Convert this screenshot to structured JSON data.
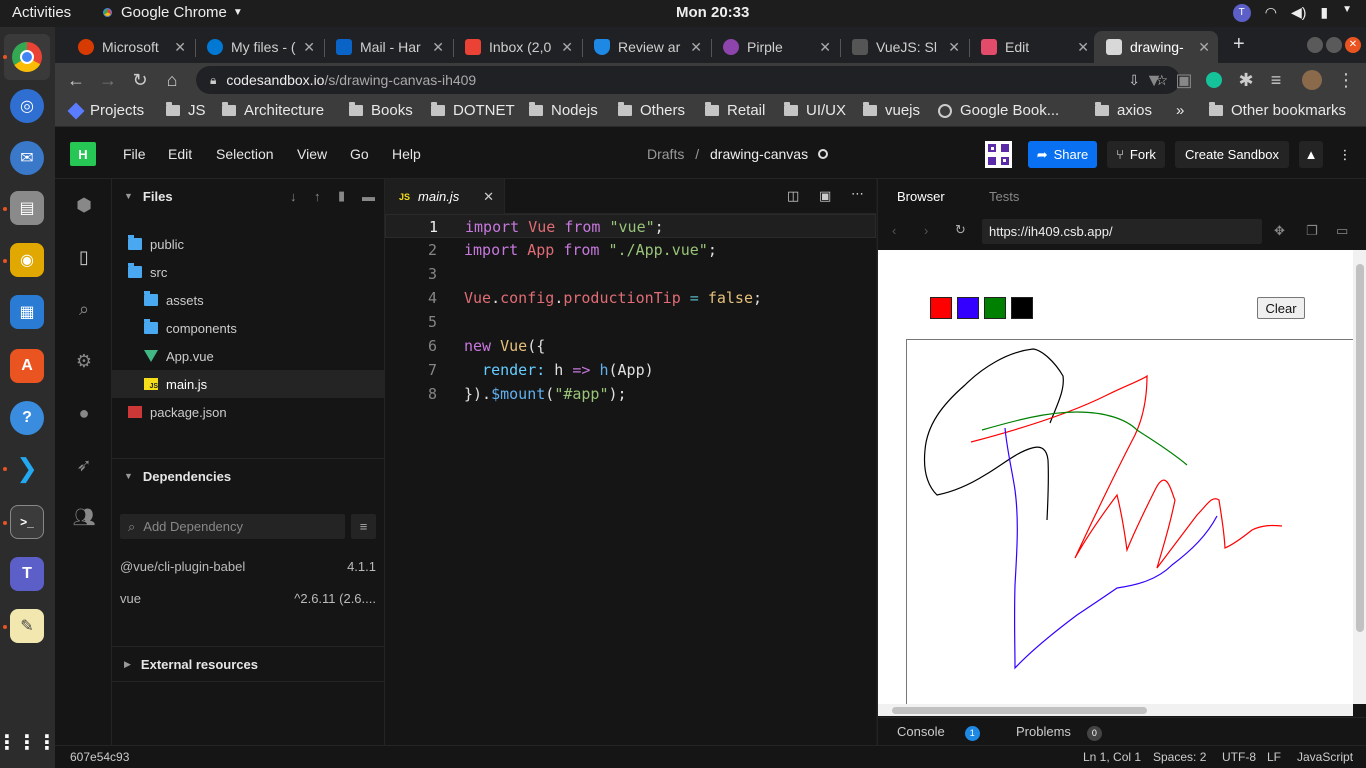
{
  "os": {
    "activities": "Activities",
    "app_name": "Google Chrome",
    "clock": "Mon 20:33"
  },
  "chrome": {
    "tabs": [
      {
        "title": "Microsoft",
        "color": "#d83b01"
      },
      {
        "title": "My files - (",
        "color": "#0078d4"
      },
      {
        "title": "Mail - Har",
        "color": "#0a64c8"
      },
      {
        "title": "Inbox (2,0",
        "color": "#ea4335"
      },
      {
        "title": "Review ar",
        "color": "#1e88e5"
      },
      {
        "title": "Pirple",
        "color": "#8e44ad"
      },
      {
        "title": "VueJS: Sl",
        "color": "#333333"
      },
      {
        "title": "Edit",
        "color": "#e34b6b"
      },
      {
        "title": "drawing-",
        "color": "#d8d8d8"
      }
    ],
    "url_host": "codesandbox.io",
    "url_path": "/s/drawing-canvas-ih409",
    "bookmarks": [
      "Projects",
      "JS",
      "Architecture",
      "Books",
      "DOTNET",
      "Nodejs",
      "Others",
      "Retail",
      "UI/UX",
      "vuejs",
      "Google Book...",
      "axios",
      "»",
      "Other bookmarks"
    ]
  },
  "csb": {
    "logo": "H",
    "menu": [
      "File",
      "Edit",
      "Selection",
      "View",
      "Go",
      "Help"
    ],
    "breadcrumb_root": "Drafts",
    "breadcrumb_sep": "/",
    "sandbox_name": "drawing-canvas",
    "share": "Share",
    "fork": "Fork",
    "create": "Create Sandbox"
  },
  "sidebar": {
    "files_title": "Files",
    "tree": [
      {
        "name": "public",
        "type": "folder",
        "indent": 0
      },
      {
        "name": "src",
        "type": "folder",
        "indent": 0
      },
      {
        "name": "assets",
        "type": "folder",
        "indent": 1
      },
      {
        "name": "components",
        "type": "folder",
        "indent": 1
      },
      {
        "name": "App.vue",
        "type": "vue",
        "indent": 1
      },
      {
        "name": "main.js",
        "type": "js",
        "indent": 1,
        "selected": true
      },
      {
        "name": "package.json",
        "type": "npm",
        "indent": 0
      }
    ],
    "deps_title": "Dependencies",
    "add_dep_placeholder": "Add Dependency",
    "deps": [
      {
        "name": "@vue/cli-plugin-babel",
        "version": "4.1.1"
      },
      {
        "name": "vue",
        "version": "^2.6.11 (2.6...."
      }
    ],
    "external_title": "External resources"
  },
  "editor": {
    "tab_label": "main.js",
    "line_numbers": [
      "1",
      "2",
      "3",
      "4",
      "5",
      "6",
      "7",
      "8"
    ]
  },
  "browser": {
    "tab_browser": "Browser",
    "tab_tests": "Tests",
    "url": "https://ih409.csb.app/",
    "colors": [
      "#ff0000",
      "#3300ff",
      "#008000",
      "#000000"
    ],
    "clear": "Clear",
    "console": "Console",
    "console_count": "1",
    "problems": "Problems",
    "problems_count": "0"
  },
  "status": {
    "hash": "607e54c93",
    "position": "Ln 1, Col 1",
    "spaces": "Spaces: 2",
    "encoding": "UTF-8",
    "eol": "LF",
    "language": "JavaScript"
  }
}
